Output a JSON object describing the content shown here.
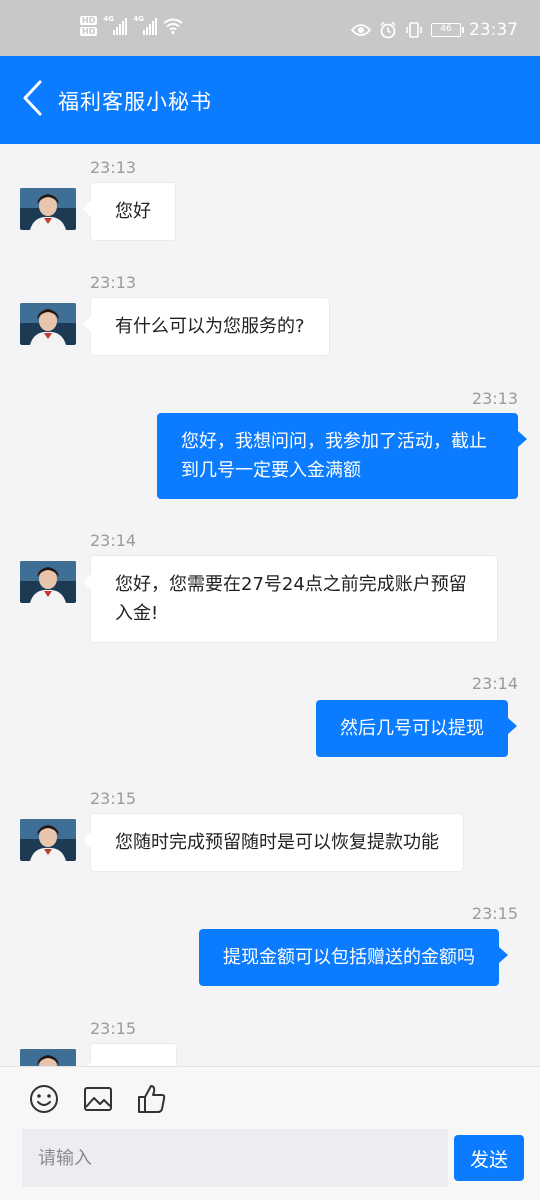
{
  "status_bar": {
    "hd1": "HD",
    "hd2": "HD",
    "net1": "4G",
    "net2": "4G",
    "battery": "46",
    "time": "23:37"
  },
  "header": {
    "title": "福利客服小秘书"
  },
  "messages": [
    {
      "time": "23:13",
      "side": "in",
      "text": "您好"
    },
    {
      "time": "23:13",
      "side": "in",
      "text": "有什么可以为您服务的?"
    },
    {
      "time": "23:13",
      "side": "out",
      "text": "您好，我想问问，我参加了活动，截止到几号一定要入金满额"
    },
    {
      "time": "23:14",
      "side": "in",
      "text": "您好，您需要在27号24点之前完成账户预留入金!"
    },
    {
      "time": "23:14",
      "side": "out",
      "text": "然后几号可以提现"
    },
    {
      "time": "23:15",
      "side": "in",
      "text": "您随时完成预留随时是可以恢复提款功能"
    },
    {
      "time": "23:15",
      "side": "out",
      "text": "提现金额可以包括赠送的金额吗"
    },
    {
      "time": "23:15",
      "side": "in",
      "text": ""
    }
  ],
  "input": {
    "placeholder": "请输入",
    "send_label": "发送"
  },
  "colors": {
    "accent": "#0b7cff",
    "status_bar": "#c8c8c8",
    "background": "#f4f4f6"
  },
  "icons": [
    "back-arrow-icon",
    "emoji-icon",
    "image-icon",
    "thumbs-up-icon",
    "wifi-icon",
    "eye-icon",
    "alarm-icon",
    "vibrate-icon",
    "battery-icon"
  ]
}
